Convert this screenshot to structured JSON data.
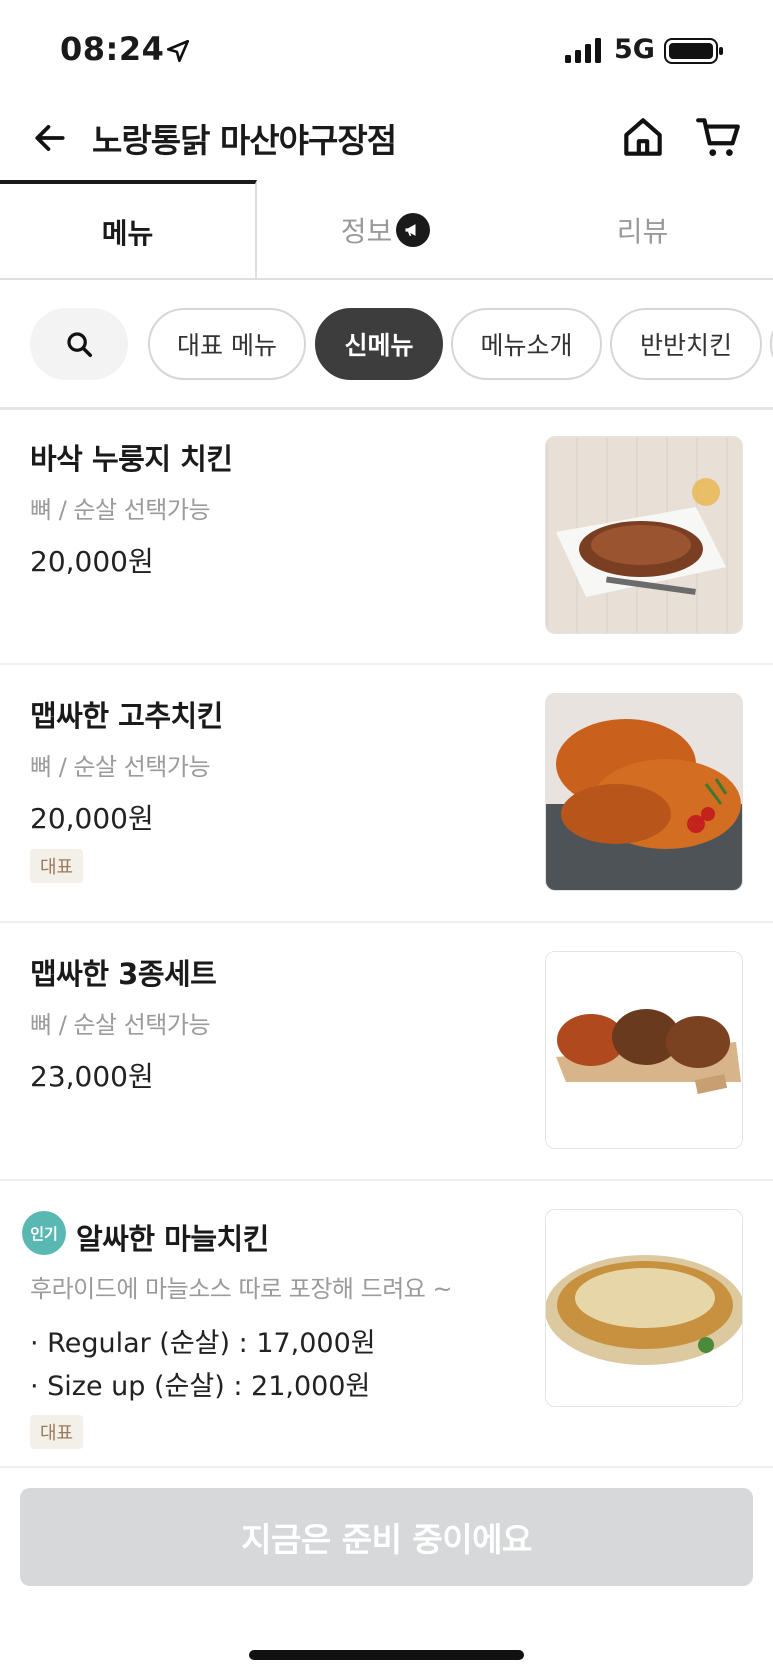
{
  "status_bar": {
    "time": "08:24",
    "network": "5G"
  },
  "header": {
    "title": "노랑통닭 마산야구장점"
  },
  "tabs": [
    {
      "label": "메뉴"
    },
    {
      "label": "정보"
    },
    {
      "label": "리뷰"
    }
  ],
  "chips": [
    {
      "label": "대표 메뉴"
    },
    {
      "label": "신메뉴"
    },
    {
      "label": "메뉴소개"
    },
    {
      "label": "반반치킨"
    }
  ],
  "menu": [
    {
      "name": "바삭 누룽지 치킨",
      "desc": "뼈 / 순살 선택가능",
      "price": "20,000원"
    },
    {
      "name": "맵싸한 고추치킨",
      "desc": "뼈 / 순살 선택가능",
      "price": "20,000원",
      "tag": "대표"
    },
    {
      "name": "맵싸한 3종세트",
      "desc": "뼈 / 순살 선택가능",
      "price": "23,000원"
    },
    {
      "badge": "인기",
      "name": "알싸한 마늘치킨",
      "desc": "후라이드에 마늘소스 따로 포장해 드려요 ~",
      "options": [
        "· Regular (순살) : 17,000원",
        "· Size up (순살) : 21,000원"
      ],
      "tag": "대표"
    }
  ],
  "order_button": {
    "label": "지금은 준비 중이에요"
  },
  "colors": {
    "active_chip": "#3d3d3d",
    "popular_badge": "#5ab8b2",
    "tag_bg": "#f3efe9",
    "tag_text": "#9a7a5a",
    "disabled_button": "#d7d8da"
  }
}
